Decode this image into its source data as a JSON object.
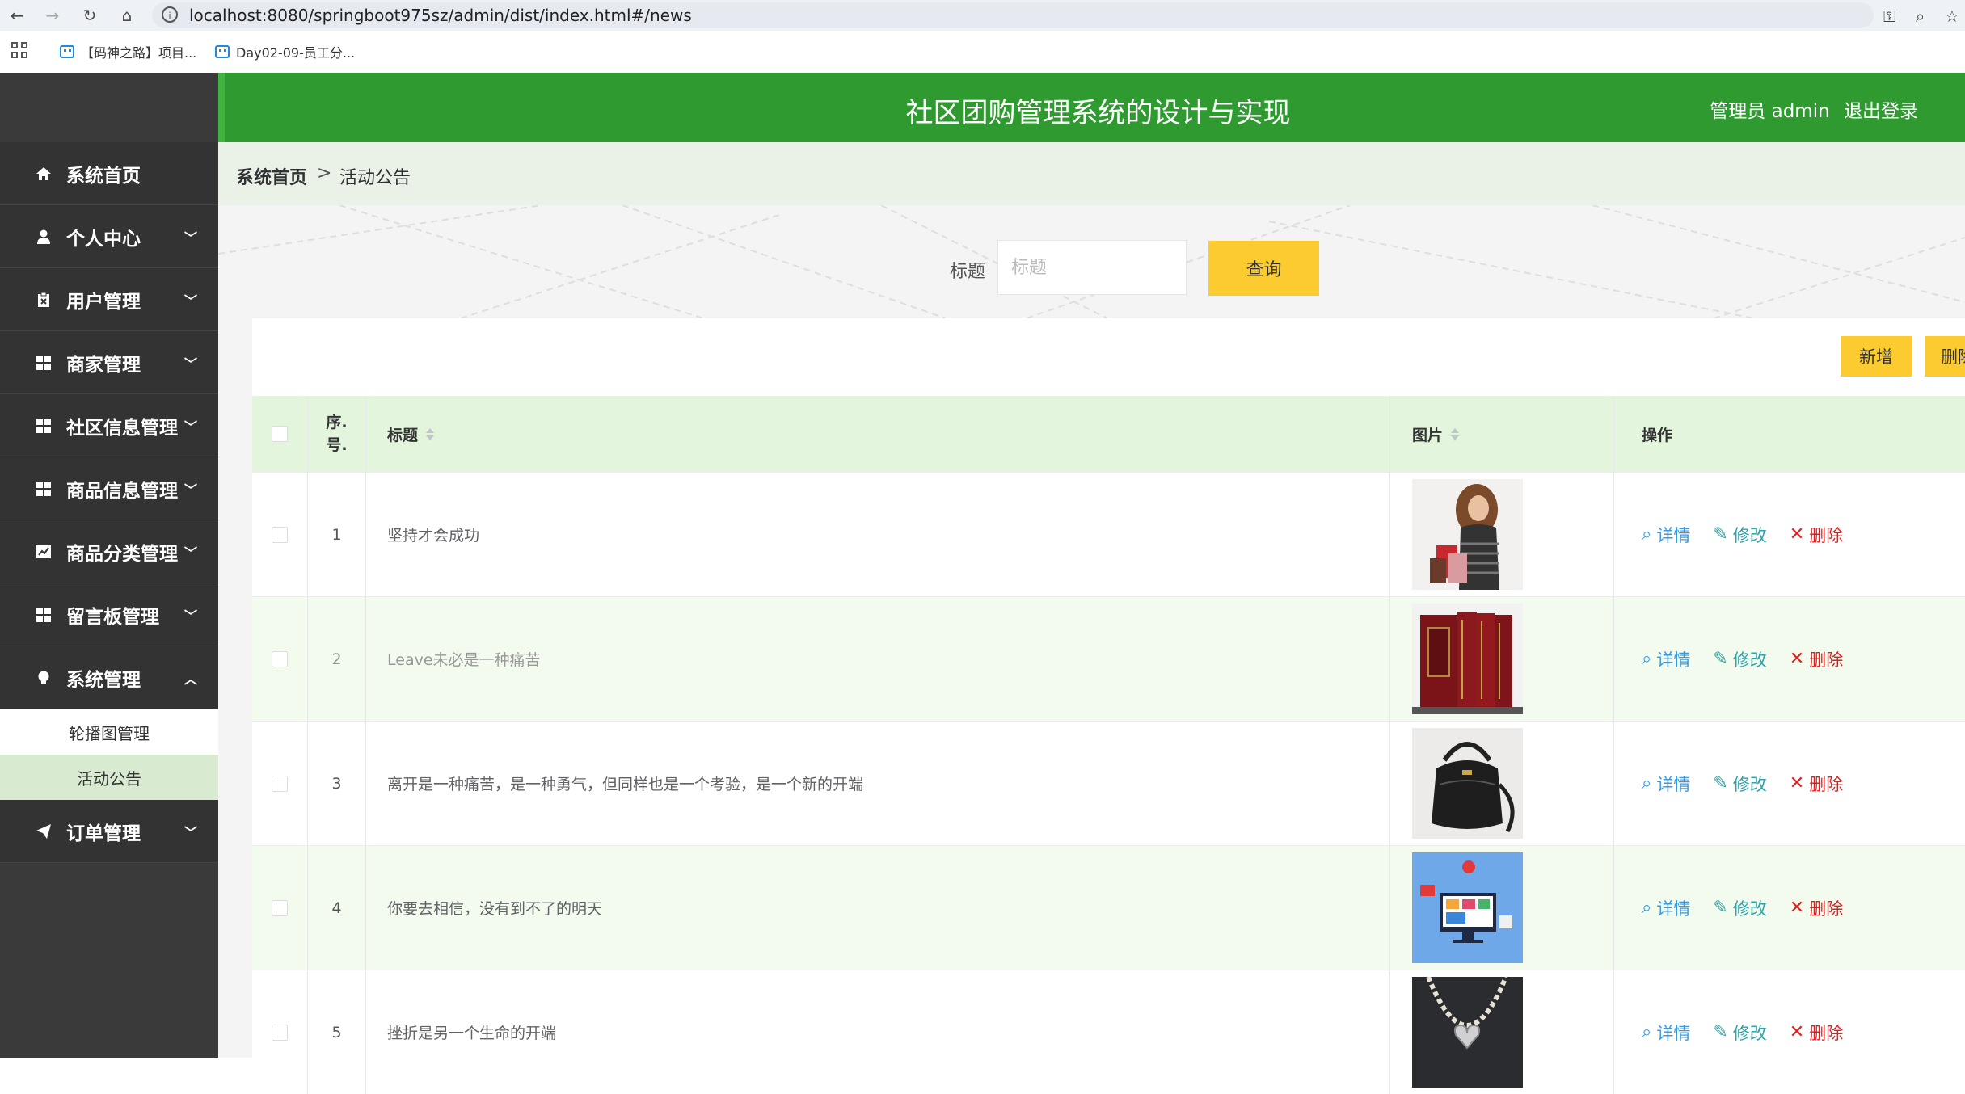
{
  "browser": {
    "url": "localhost:8080/springboot975sz/admin/dist/index.html#/news",
    "bookmarks": [
      {
        "label": "【码神之路】项目..."
      },
      {
        "label": "Day02-09-员工分..."
      }
    ]
  },
  "header": {
    "title": "社区团购管理系统的设计与实现",
    "role": "管理员 admin",
    "logout": "退出登录"
  },
  "sidebar": {
    "items": [
      {
        "label": "系统首页",
        "icon": "home-icon"
      },
      {
        "label": "个人中心",
        "icon": "user-icon"
      },
      {
        "label": "用户管理",
        "icon": "clipboard-icon"
      },
      {
        "label": "商家管理",
        "icon": "grid-icon"
      },
      {
        "label": "社区信息管理",
        "icon": "grid-icon"
      },
      {
        "label": "商品信息管理",
        "icon": "grid-icon"
      },
      {
        "label": "商品分类管理",
        "icon": "chart-icon"
      },
      {
        "label": "留言板管理",
        "icon": "grid-icon"
      },
      {
        "label": "系统管理",
        "icon": "bulb-icon"
      },
      {
        "label": "订单管理",
        "icon": "send-icon"
      }
    ],
    "submenu": [
      {
        "label": "轮播图管理"
      },
      {
        "label": "活动公告"
      }
    ]
  },
  "breadcrumb": {
    "home": "系统首页",
    "separator": ">",
    "current": "活动公告"
  },
  "search": {
    "label": "标题",
    "placeholder": "标题",
    "button": "查询"
  },
  "actions": {
    "add": "新增",
    "delete": "删除"
  },
  "table": {
    "headers": {
      "index": "序.\n号.",
      "title": "标题",
      "image": "图片",
      "ops": "操作"
    },
    "rows": [
      {
        "num": "1",
        "title": "坚持才会成功",
        "image": "woman-shopping-photo"
      },
      {
        "num": "2",
        "title": "Leave未必是一种痛苦",
        "image": "red-books-photo"
      },
      {
        "num": "3",
        "title": "离开是一种痛苦，是一种勇气，但同样也是一个考验，是一个新的开端",
        "image": "black-handbag-photo"
      },
      {
        "num": "4",
        "title": "你要去相信，没有到不了的明天",
        "image": "online-shopping-illustration"
      },
      {
        "num": "5",
        "title": "挫折是另一个生命的开端",
        "image": "heart-necklace-photo"
      }
    ],
    "ops": {
      "detail": "详情",
      "edit": "修改",
      "delete": "删除"
    }
  },
  "colors": {
    "header_green": "#2e9a30",
    "sidebar_dark": "#333333",
    "button_yellow": "#fbcb2f",
    "row_alt": "#f2fbee"
  }
}
